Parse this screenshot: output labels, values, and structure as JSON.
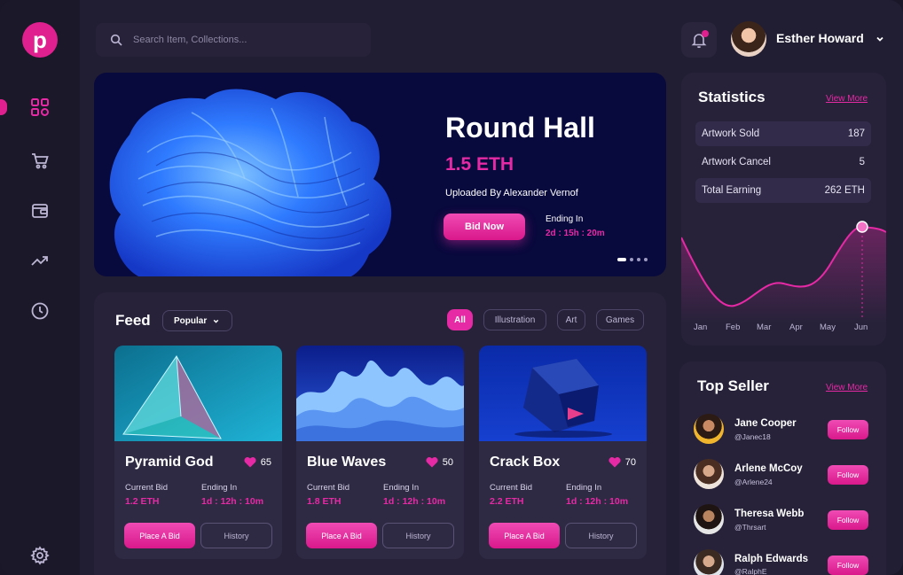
{
  "brand": {
    "logo_letter": "p"
  },
  "search": {
    "placeholder": "Search Item, Collections..."
  },
  "user": {
    "name": "Esther Howard"
  },
  "hero": {
    "title": "Round Hall",
    "price": "1.5 ETH",
    "uploader": "Uploaded By Alexander Vernof",
    "bid_label": "Bid Now",
    "ending_label": "Ending In",
    "ending_value": "2d : 15h : 20m"
  },
  "feed": {
    "title": "Feed",
    "sort_label": "Popular",
    "filters": [
      "All",
      "Illustration",
      "Art",
      "Games"
    ],
    "cards": [
      {
        "name": "Pyramid God",
        "likes": "65",
        "current_bid_label": "Current Bid",
        "current_bid": "1.2 ETH",
        "ending_label": "Ending In",
        "ending": "1d : 12h : 10m",
        "bid_button": "Place A Bid",
        "history_button": "History"
      },
      {
        "name": "Blue Waves",
        "likes": "50",
        "current_bid_label": "Current Bid",
        "current_bid": "1.8 ETH",
        "ending_label": "Ending In",
        "ending": "1d : 12h : 10m",
        "bid_button": "Place A Bid",
        "history_button": "History"
      },
      {
        "name": "Crack Box",
        "likes": "70",
        "current_bid_label": "Current Bid",
        "current_bid": "2.2 ETH",
        "ending_label": "Ending In",
        "ending": "1d : 12h : 10m",
        "bid_button": "Place A Bid",
        "history_button": "History"
      }
    ]
  },
  "statistics": {
    "title": "Statistics",
    "view_more": "View More",
    "rows": [
      {
        "label": "Artwork Sold",
        "value": "187"
      },
      {
        "label": "Artwork Cancel",
        "value": "5"
      },
      {
        "label": "Total Earning",
        "value": "262 ETH"
      }
    ],
    "months": [
      "Jan",
      "Feb",
      "Mar",
      "Apr",
      "May",
      "Jun"
    ]
  },
  "top_seller": {
    "title": "Top Seller",
    "view_more": "View More",
    "sellers": [
      {
        "name": "Jane Cooper",
        "handle": "@Janec18",
        "follow": "Follow"
      },
      {
        "name": "Arlene McCoy",
        "handle": "@Arlene24",
        "follow": "Follow"
      },
      {
        "name": "Theresa Webb",
        "handle": "@Thrsart",
        "follow": "Follow"
      },
      {
        "name": "Ralph Edwards",
        "handle": "@RalphE",
        "follow": "Follow"
      }
    ]
  },
  "colors": {
    "accent": "#e629a4",
    "background": "#211d33",
    "panel": "#27223a"
  },
  "icons": [
    "dashboard-icon",
    "cart-icon",
    "wallet-icon",
    "trend-icon",
    "clock-icon",
    "settings-icon",
    "search-icon",
    "bell-icon",
    "heart-icon"
  ]
}
